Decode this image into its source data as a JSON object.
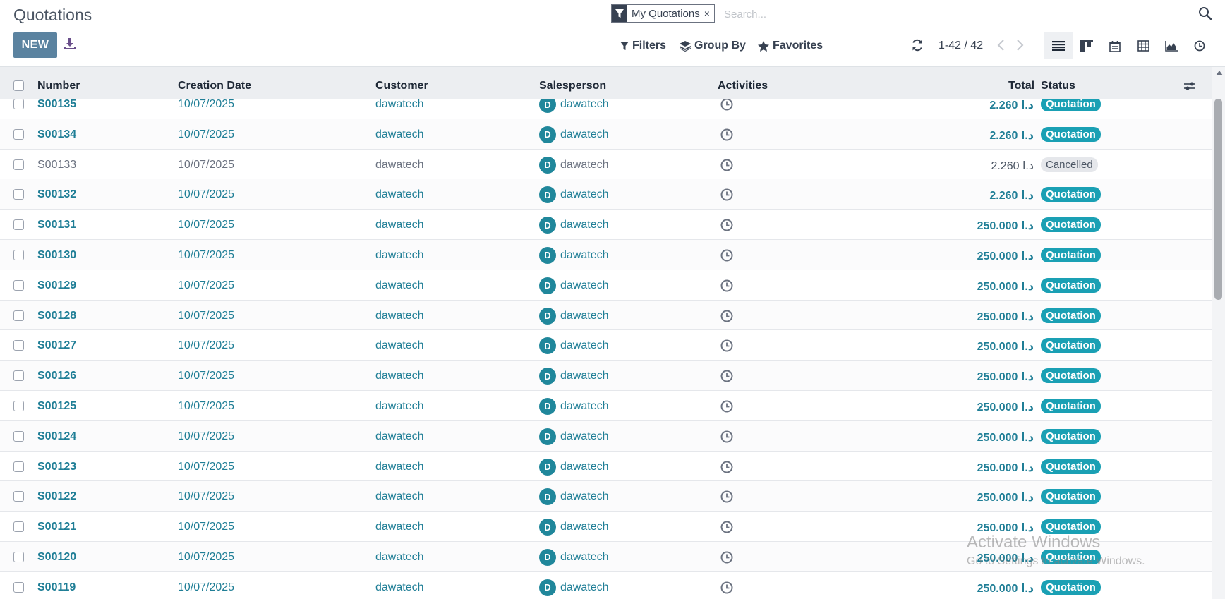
{
  "header": {
    "title": "Quotations",
    "new_label": "NEW"
  },
  "search": {
    "facet_value": "My Quotations",
    "facet_remove": "×",
    "placeholder": "Search..."
  },
  "search_options": {
    "filters": "Filters",
    "group_by": "Group By",
    "favorites": "Favorites"
  },
  "pager": {
    "value": "1-42 / 42"
  },
  "columns": {
    "number": "Number",
    "creation_date": "Creation Date",
    "customer": "Customer",
    "salesperson": "Salesperson",
    "activities": "Activities",
    "total": "Total",
    "status": "Status"
  },
  "rows": [
    {
      "number": "S00135",
      "date": "10/07/2025",
      "customer": "dawatech",
      "avatar": "D",
      "salesperson": "dawatech",
      "total": "2.260  د.ا",
      "status": "Quotation"
    },
    {
      "number": "S00134",
      "date": "10/07/2025",
      "customer": "dawatech",
      "avatar": "D",
      "salesperson": "dawatech",
      "total": "2.260  د.ا",
      "status": "Quotation"
    },
    {
      "number": "S00133",
      "date": "10/07/2025",
      "customer": "dawatech",
      "avatar": "D",
      "salesperson": "dawatech",
      "total": "2.260  د.ا",
      "status": "Cancelled"
    },
    {
      "number": "S00132",
      "date": "10/07/2025",
      "customer": "dawatech",
      "avatar": "D",
      "salesperson": "dawatech",
      "total": "2.260  د.ا",
      "status": "Quotation"
    },
    {
      "number": "S00131",
      "date": "10/07/2025",
      "customer": "dawatech",
      "avatar": "D",
      "salesperson": "dawatech",
      "total": "250.000  د.ا",
      "status": "Quotation"
    },
    {
      "number": "S00130",
      "date": "10/07/2025",
      "customer": "dawatech",
      "avatar": "D",
      "salesperson": "dawatech",
      "total": "250.000  د.ا",
      "status": "Quotation"
    },
    {
      "number": "S00129",
      "date": "10/07/2025",
      "customer": "dawatech",
      "avatar": "D",
      "salesperson": "dawatech",
      "total": "250.000  د.ا",
      "status": "Quotation"
    },
    {
      "number": "S00128",
      "date": "10/07/2025",
      "customer": "dawatech",
      "avatar": "D",
      "salesperson": "dawatech",
      "total": "250.000  د.ا",
      "status": "Quotation"
    },
    {
      "number": "S00127",
      "date": "10/07/2025",
      "customer": "dawatech",
      "avatar": "D",
      "salesperson": "dawatech",
      "total": "250.000  د.ا",
      "status": "Quotation"
    },
    {
      "number": "S00126",
      "date": "10/07/2025",
      "customer": "dawatech",
      "avatar": "D",
      "salesperson": "dawatech",
      "total": "250.000  د.ا",
      "status": "Quotation"
    },
    {
      "number": "S00125",
      "date": "10/07/2025",
      "customer": "dawatech",
      "avatar": "D",
      "salesperson": "dawatech",
      "total": "250.000  د.ا",
      "status": "Quotation"
    },
    {
      "number": "S00124",
      "date": "10/07/2025",
      "customer": "dawatech",
      "avatar": "D",
      "salesperson": "dawatech",
      "total": "250.000  د.ا",
      "status": "Quotation"
    },
    {
      "number": "S00123",
      "date": "10/07/2025",
      "customer": "dawatech",
      "avatar": "D",
      "salesperson": "dawatech",
      "total": "250.000  د.ا",
      "status": "Quotation"
    },
    {
      "number": "S00122",
      "date": "10/07/2025",
      "customer": "dawatech",
      "avatar": "D",
      "salesperson": "dawatech",
      "total": "250.000  د.ا",
      "status": "Quotation"
    },
    {
      "number": "S00121",
      "date": "10/07/2025",
      "customer": "dawatech",
      "avatar": "D",
      "salesperson": "dawatech",
      "total": "250.000  د.ا",
      "status": "Quotation"
    },
    {
      "number": "S00120",
      "date": "10/07/2025",
      "customer": "dawatech",
      "avatar": "D",
      "salesperson": "dawatech",
      "total": "250.000  د.ا",
      "status": "Quotation"
    },
    {
      "number": "S00119",
      "date": "10/07/2025",
      "customer": "dawatech",
      "avatar": "D",
      "salesperson": "dawatech",
      "total": "250.000  د.ا",
      "status": "Quotation"
    }
  ],
  "watermark": {
    "line1": "Activate Windows",
    "line2": "Go to Settings to activate Windows."
  },
  "colors": {
    "primary_button": "#5b83a0",
    "link": "#1f7e96",
    "status_quotation": "#1aa0b4",
    "status_cancelled": "#e5e7eb"
  }
}
